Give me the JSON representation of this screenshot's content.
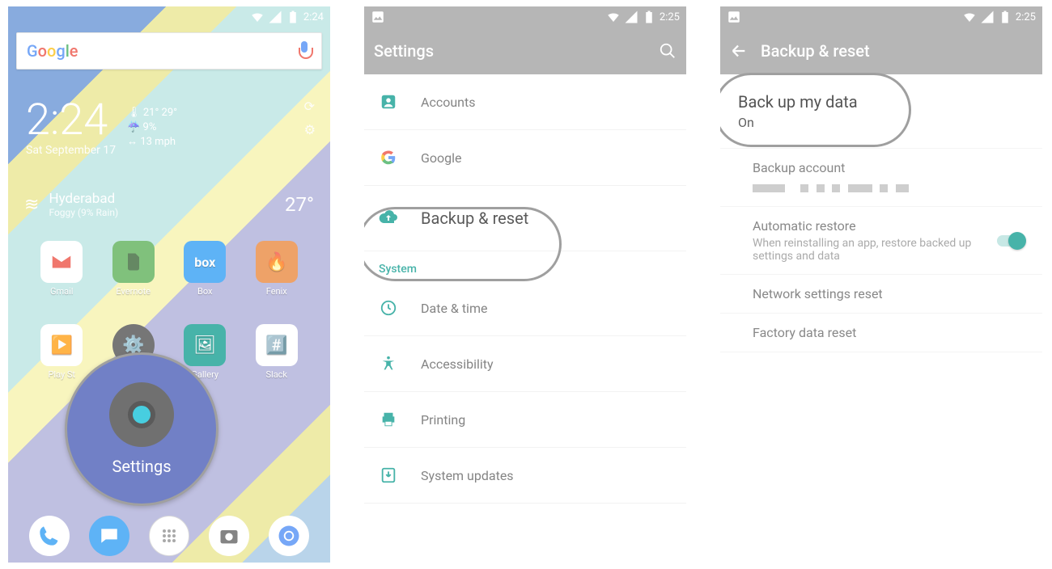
{
  "screen1": {
    "status_time": "2:24",
    "search_placeholder": "Google",
    "clock_time": "2:24",
    "clock_date": "Sat September 17",
    "weather_temp_range": "21° 29°",
    "weather_rain": "9%",
    "weather_wind": "13 mph",
    "location_city": "Hyderabad",
    "location_cond": "Foggy (9% Rain)",
    "location_temp": "27°",
    "apps": {
      "gmail": "Gmail",
      "evernote": "Evernote",
      "box": "Box",
      "fenix": "Fenix",
      "playstore": "Play St",
      "settings": "Settings",
      "gallery": "Gallery",
      "slack": "Slack"
    },
    "bubble_label": "Settings"
  },
  "screen2": {
    "status_time": "2:25",
    "title": "Settings",
    "items": {
      "accounts": "Accounts",
      "google": "Google",
      "backup": "Backup & reset",
      "system_header": "System",
      "datetime": "Date & time",
      "accessibility": "Accessibility",
      "printing": "Printing",
      "updates": "System updates"
    }
  },
  "screen3": {
    "status_time": "2:25",
    "title": "Backup & reset",
    "backup_title": "Back up my data",
    "backup_state": "On",
    "account_title": "Backup account",
    "auto_title": "Automatic restore",
    "auto_sub": "When reinstalling an app, restore backed up settings and data",
    "netreset": "Network settings reset",
    "factory": "Factory data reset"
  }
}
